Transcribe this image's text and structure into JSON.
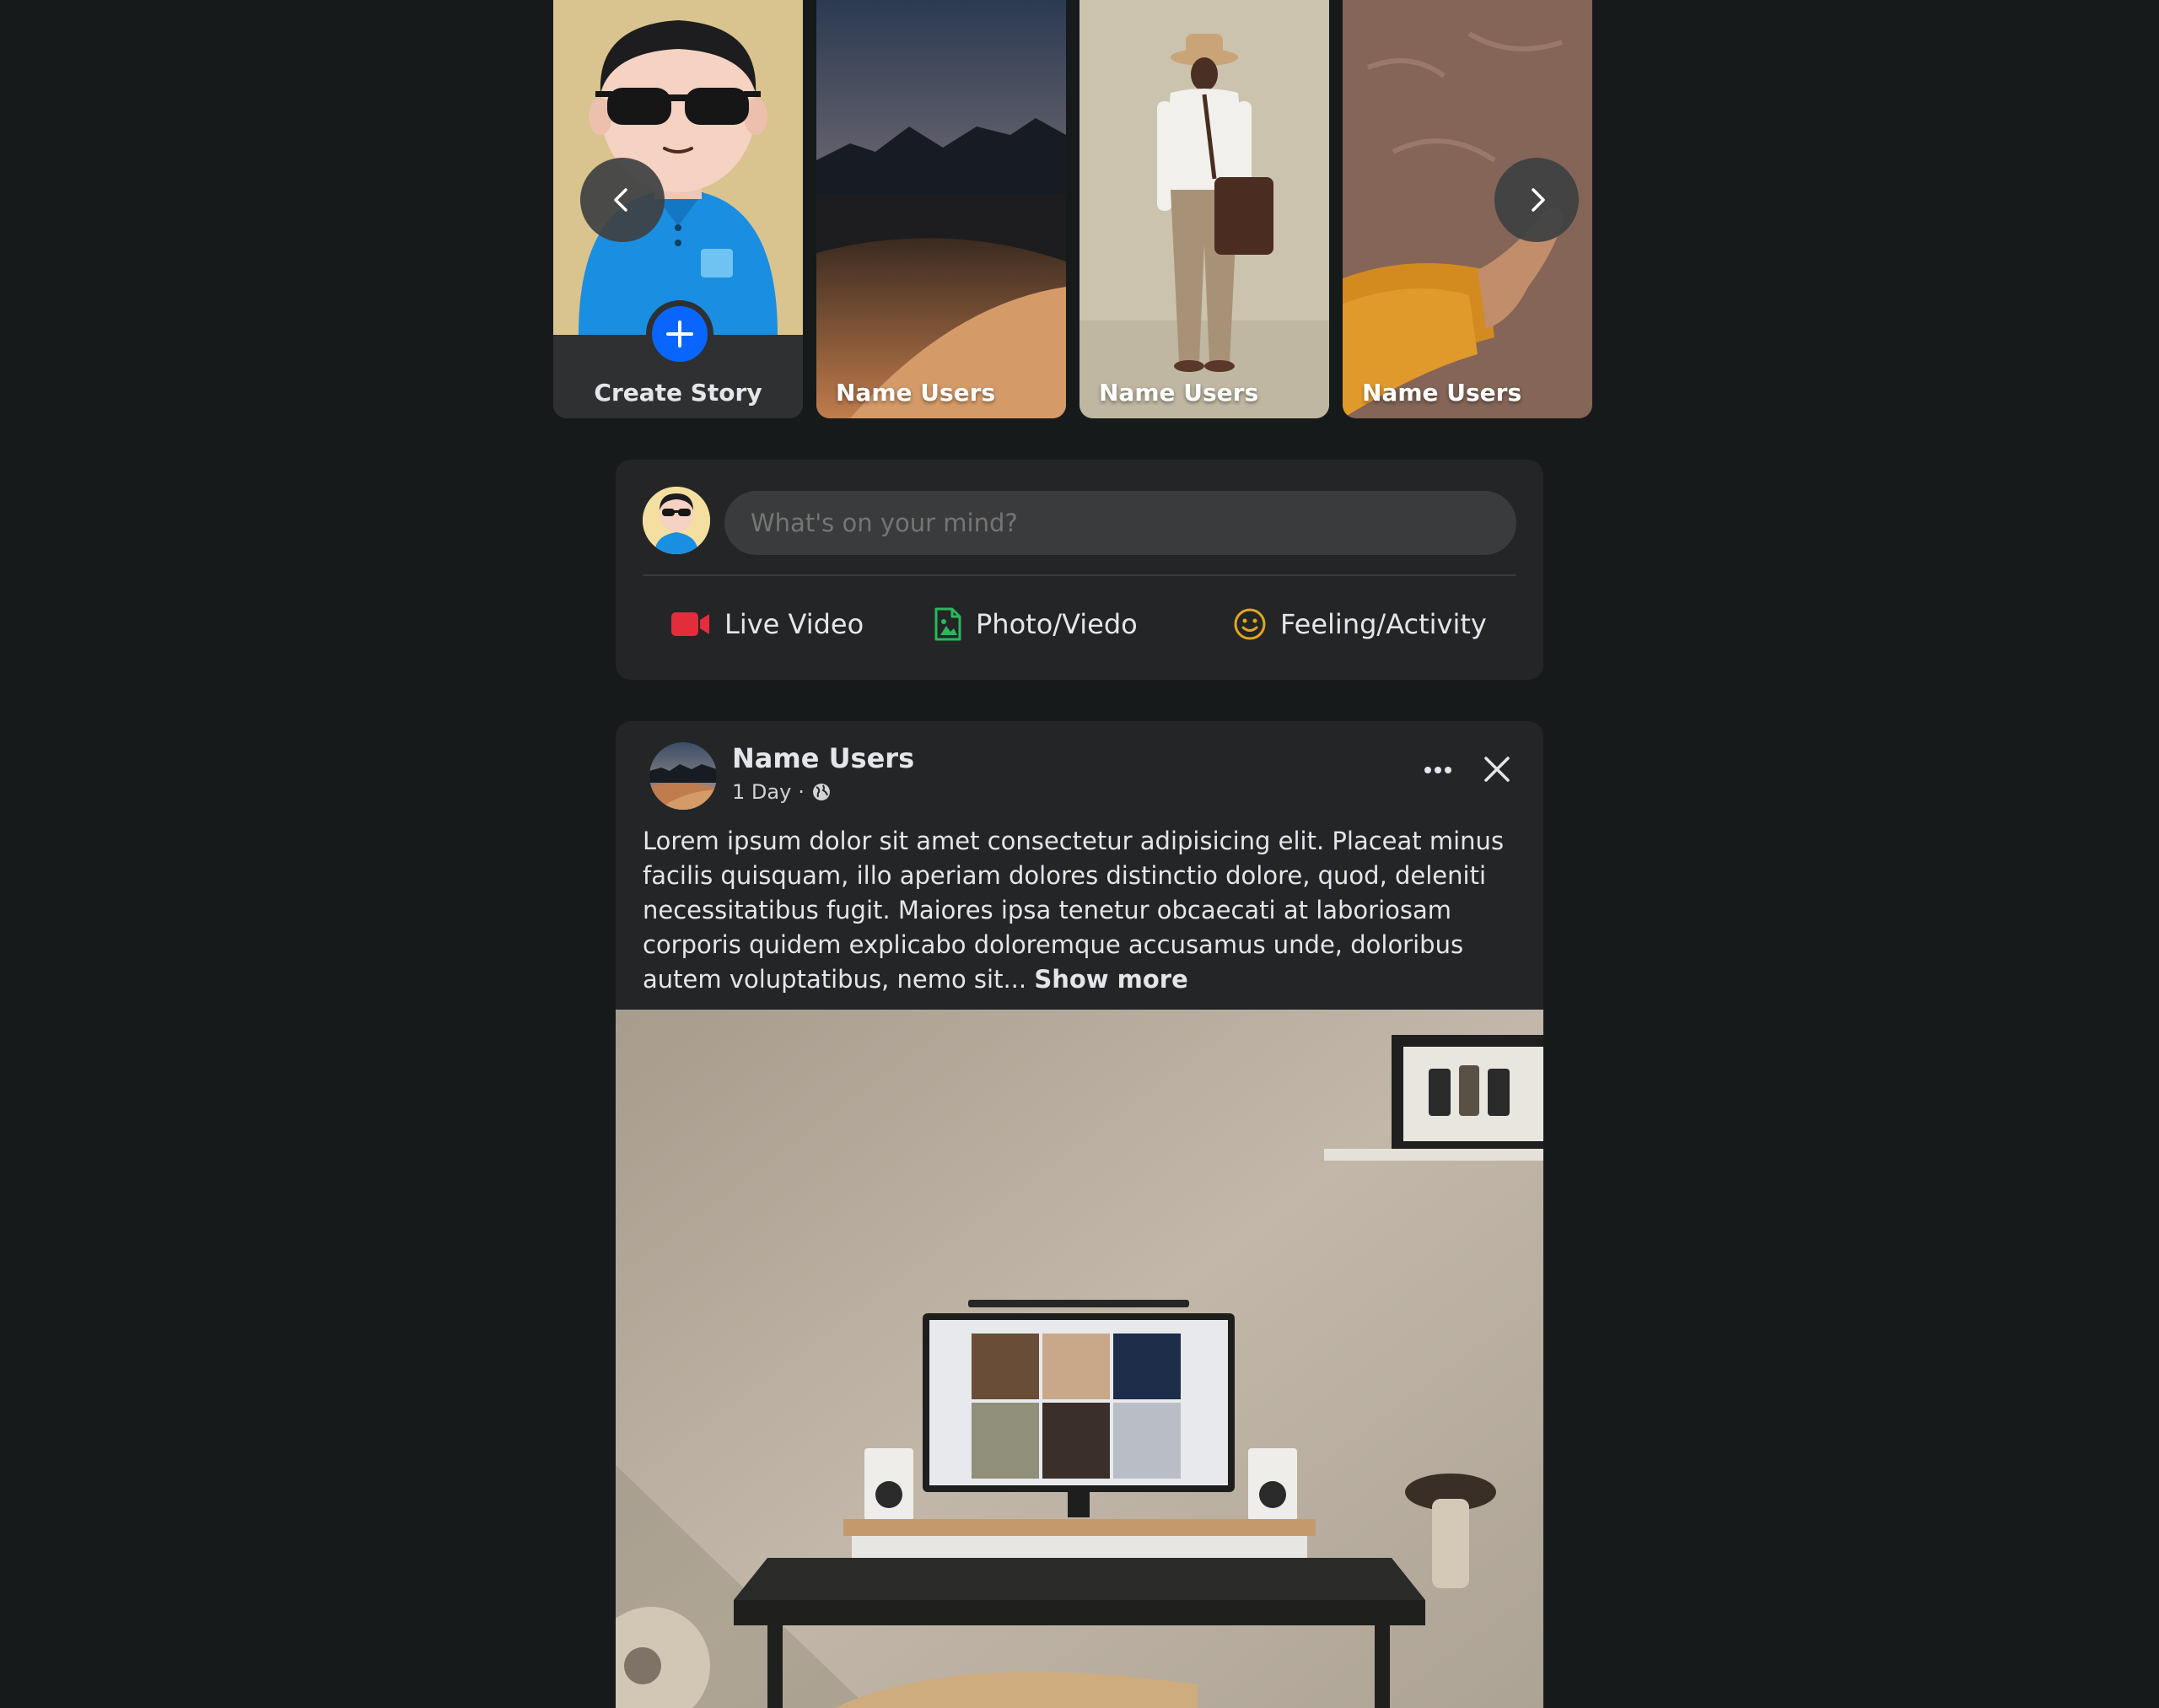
{
  "stories": {
    "create_label": "Create Story",
    "items": [
      {
        "name": "Name Users"
      },
      {
        "name": "Name Users"
      },
      {
        "name": "Name Users"
      }
    ]
  },
  "composer": {
    "placeholder": "What's on your mind?",
    "actions": [
      {
        "label": "Live Video",
        "icon": "video-camera-icon",
        "color": "#e42d3a"
      },
      {
        "label": "Photo/Viedo",
        "icon": "photo-file-icon",
        "color": "#2bb75b"
      },
      {
        "label": "Feeling/Activity",
        "icon": "smiley-icon",
        "color": "#e2a720"
      }
    ]
  },
  "post": {
    "author": "Name Users",
    "time": "1 Day",
    "separator": "·",
    "text": "Lorem ipsum dolor sit amet consectetur adipisicing elit. Placeat minus facilis quisquam, illo aperiam dolores distinctio dolore, quod, deleniti necessitatibus fugit. Maiores ipsa tenetur obcaecati at laboriosam corporis quidem explicabo doloremque accusamus unde, doloribus autem voluptatibus, nemo sit...",
    "show_more": "Show more"
  },
  "colors": {
    "background": "#171a1b",
    "card": "#232526",
    "accent": "#0866ff"
  }
}
